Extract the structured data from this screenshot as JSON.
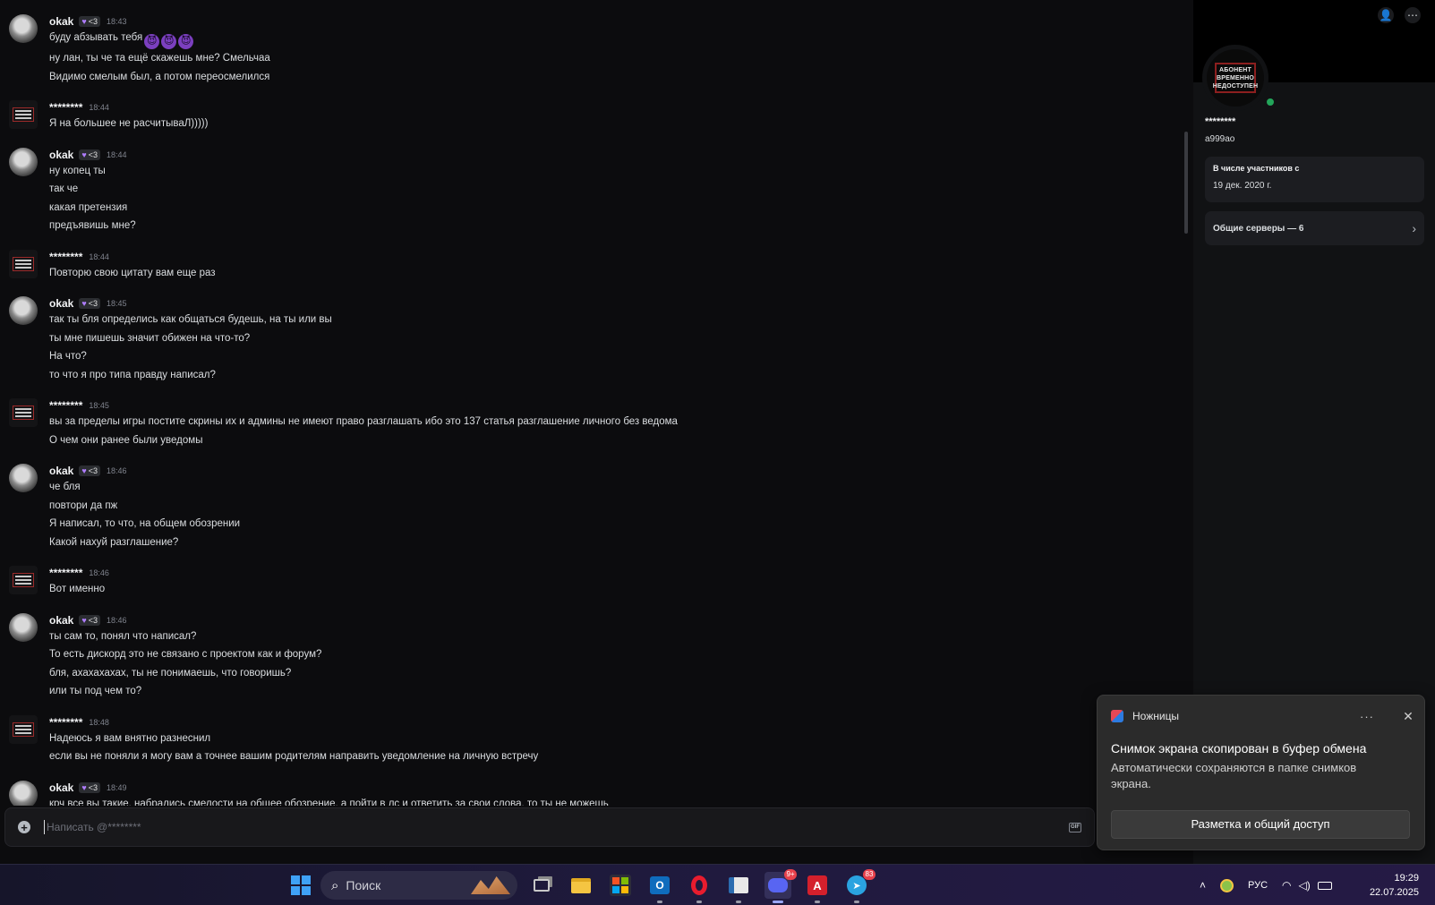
{
  "messages": [
    {
      "author": "okak",
      "avatar": "cat",
      "tag": "<3",
      "time": "18:43",
      "lines": [
        "буду абзывать тебя",
        "ну лан, ты че та ещё скажешь мне? Смельчаа",
        "Видимо смелым был, а потом переосмелился"
      ],
      "emoji_on_first": true
    },
    {
      "author": "********",
      "avatar": "sign",
      "time": "18:44",
      "lines": [
        "Я на большее не расчитываЛ)))))"
      ]
    },
    {
      "author": "okak",
      "avatar": "cat",
      "tag": "<3",
      "time": "18:44",
      "lines": [
        "ну копец ты",
        "так че",
        "какая претензия",
        "предъявишь мне?"
      ]
    },
    {
      "author": "********",
      "avatar": "sign",
      "time": "18:44",
      "lines": [
        "Повторю свою цитату вам еще раз"
      ]
    },
    {
      "author": "okak",
      "avatar": "cat",
      "tag": "<3",
      "time": "18:45",
      "lines": [
        "так ты бля определись как общаться будешь, на ты или вы",
        "ты мне пишешь значит обижен на что-то?",
        "На что?",
        "то что я про типа правду написал?"
      ]
    },
    {
      "author": "********",
      "avatar": "sign",
      "time": "18:45",
      "lines": [
        "вы за пределы игры постите скрины их и админы не имеют право разглашать ибо это 137 статья разглашение личного без ведома",
        "О чем они ранее были уведомы"
      ]
    },
    {
      "author": "okak",
      "avatar": "cat",
      "tag": "<3",
      "time": "18:46",
      "lines": [
        "че бля",
        "повтори да пж",
        "Я написал, то что, на общем обозрении",
        "Какой нахуй разглашение?"
      ]
    },
    {
      "author": "********",
      "avatar": "sign",
      "time": "18:46",
      "lines": [
        "Вот именно"
      ]
    },
    {
      "author": "okak",
      "avatar": "cat",
      "tag": "<3",
      "time": "18:46",
      "lines": [
        "ты сам то, понял что написал?",
        "То есть дискорд это не связано с проектом как и форум?",
        "бля, ахахахахах, ты не понимаешь, что говоришь?",
        "или ты под чем то?"
      ]
    },
    {
      "author": "********",
      "avatar": "sign",
      "time": "18:48",
      "lines": [
        "Надеюсь я вам внятно разнеснил",
        "если вы не поняли я могу вам а точнее вашим родителям направить уведомление на личную встречу"
      ]
    },
    {
      "author": "okak",
      "avatar": "cat",
      "tag": "<3",
      "time": "18:49",
      "lines": [
        "крч все вы такие, набрались смелости на общее обозрение, а пойти в лс и ответить за свои слова, то ты не можешь"
      ]
    }
  ],
  "emoji_glyph": "😈",
  "composer": {
    "placeholder": "Написать @********",
    "gif_label": "GIF"
  },
  "profile": {
    "display_name": "********",
    "handle": "a999ao",
    "member_since_label": "В числе участников с",
    "member_since_value": "19 дек. 2020 г.",
    "mutual_servers_label": "Общие серверы — 6",
    "avatar_text": [
      "АБОНЕНТ",
      "ВРЕМЕННО",
      "НЕДОСТУПЕН"
    ],
    "status_color": "#23a55a"
  },
  "toast": {
    "app": "Ножницы",
    "title": "Снимок экрана скопирован в буфер обмена",
    "body": "Автоматически сохраняются в папке снимков экрана.",
    "button": "Разметка и общий доступ",
    "more": "···",
    "close": "✕"
  },
  "taskbar": {
    "search_label": "Поиск",
    "discord_badge": "9+",
    "telegram_badge": "83",
    "language": "РУС",
    "time": "19:29",
    "date": "22.07.2025"
  },
  "colors": {
    "accent_green": "#23a55a",
    "badge_red": "#e8424c",
    "heart_purple": "#b07dff"
  }
}
